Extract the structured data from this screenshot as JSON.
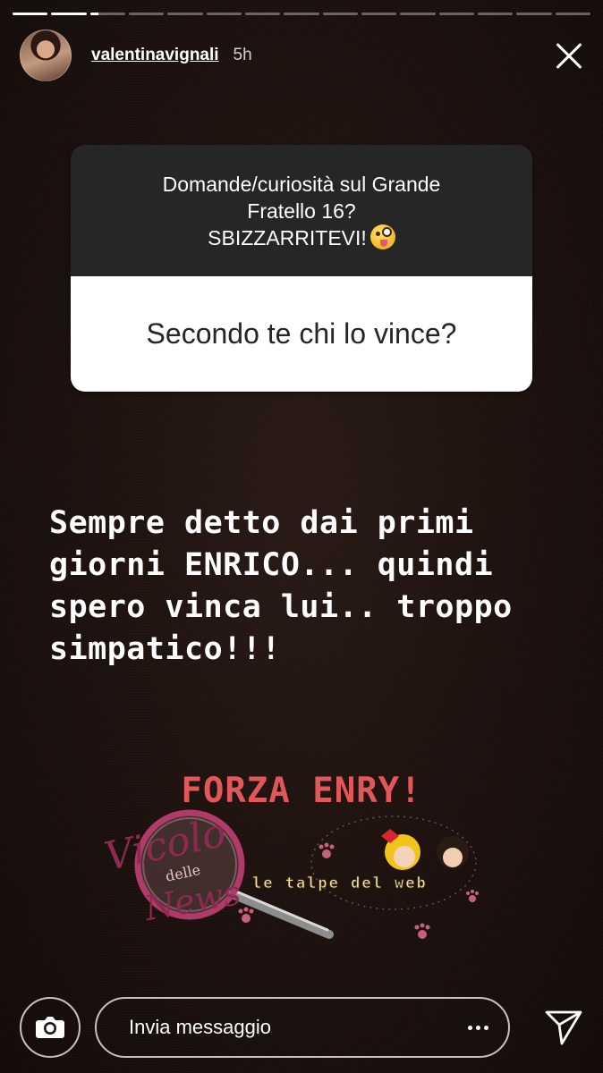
{
  "progress": {
    "segments": [
      1,
      1,
      0.25,
      0,
      0,
      0,
      0,
      0,
      0,
      0,
      0,
      0,
      0,
      0,
      0
    ]
  },
  "header": {
    "username": "valentinavignali",
    "time_ago": "5h",
    "close_icon": "close-icon"
  },
  "question_card": {
    "prompt_lines": [
      "Domande/curiosità sul Grande",
      "Fratello 16?",
      "SBIZZARRITEVI!"
    ],
    "prompt_emoji": "winking-face-with-tongue",
    "question": "Secondo te chi lo vince?"
  },
  "story_text": {
    "lines": [
      "Sempre detto dai primi",
      "giorni ENRICO... quindi",
      "spero vinca lui.. troppo",
      "simpatico!!!"
    ],
    "color": "#ffffff"
  },
  "highlight": {
    "text": "FORZA ENRY!",
    "color": "#e2585a"
  },
  "watermark": {
    "logo_text_1": "Vicolo",
    "logo_text_2": "delle",
    "logo_text_3": "News",
    "banner_text": "le talpe del web"
  },
  "bottom_bar": {
    "camera_icon": "camera-icon",
    "message_placeholder": "Invia messaggio",
    "more_icon": "more-dots-icon",
    "send_icon": "send-icon"
  }
}
